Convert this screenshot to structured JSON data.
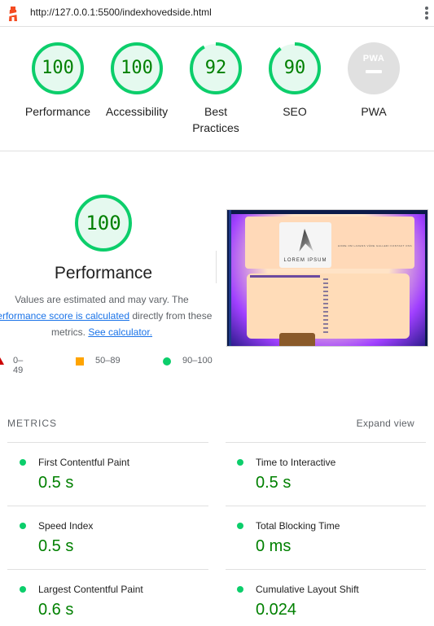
{
  "browser": {
    "url": "http://127.0.0.1:5500/indexhovedside.html"
  },
  "summary_gauges": [
    {
      "score": "100",
      "label": "Performance",
      "score_fraction": 1.0
    },
    {
      "score": "100",
      "label": "Accessibility",
      "score_fraction": 1.0
    },
    {
      "score": "92",
      "label": "Best\nPractices",
      "score_fraction": 0.92
    },
    {
      "score": "90",
      "label": "SEO",
      "score_fraction": 0.9
    }
  ],
  "pwa": {
    "badge_text": "PWA",
    "label": "PWA"
  },
  "performance": {
    "score": "100",
    "score_fraction": 1.0,
    "title": "Performance",
    "desc_prefix": "Values are estimated and may vary. The",
    "desc_link": "performance score is calculated",
    "desc_mid": "directly from these",
    "desc_metrics": "metrics.",
    "desc_calc_link": "See calculator."
  },
  "legend": {
    "fail": "0–49",
    "average": "50–89",
    "pass": "90–100"
  },
  "thumbnail": {
    "logo_text": "LOREM IPSUM",
    "nav_text": "HOME   OM LAVENS   VÅRE   GALLERI   KONTAKT OSS"
  },
  "metrics": {
    "header": "METRICS",
    "expand_label": "Expand view",
    "items": [
      {
        "title": "First Contentful Paint",
        "value": "0.5 s"
      },
      {
        "title": "Time to Interactive",
        "value": "0.5 s"
      },
      {
        "title": "Speed Index",
        "value": "0.5 s"
      },
      {
        "title": "Total Blocking Time",
        "value": "0 ms"
      },
      {
        "title": "Largest Contentful Paint",
        "value": "0.6 s"
      },
      {
        "title": "Cumulative Layout Shift",
        "value": "0.024"
      }
    ]
  },
  "colors": {
    "pass": "#0cce6b",
    "pass_text": "#008000",
    "pass_bg": "#e5f9ef",
    "average": "#ffa400",
    "fail": "#cc0000",
    "link": "#1a73e8"
  }
}
